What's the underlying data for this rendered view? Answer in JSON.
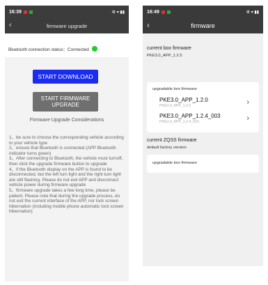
{
  "left": {
    "status_bar": {
      "time": "16:39",
      "icons": "⚙ ▾ ▮▮"
    },
    "header": {
      "title": "firmware upgrade"
    },
    "connection": {
      "label": "Bluetooth connection status：Connected"
    },
    "buttons": {
      "start_download": "START DOWNLOAD",
      "start_upgrade": "START FIRMWARE UPGRADE"
    },
    "considerations_title": "Firmware Upgrade Considerations",
    "notes": [
      "1、be sure to choose the corresponding vehicle according to your vehicle type",
      "2、ensure that Bluetooth is connected (APP Bluetooth indicator turns green)",
      "3、After connecting to Bluetooth, the vehicle must turnoff, then click the upgrade firmware button to upgrade",
      "4、if the Bluetooth display on the APP is found to be disconnected, but the left turn light and the right turn light are still flashing. Please do not exit APP and disconnect vehicle power during firmware upgrade",
      "5、firmware upgrade takes a few long time, please be patient. Please note that during the upgrade process, do not exit the current interface of the APP, nor lock screen hibernation (including mobile phone automatic lock screen hibernation)"
    ]
  },
  "right": {
    "status_bar": {
      "time": "16:49",
      "icons": "⚙ ▾ ▮▮"
    },
    "header": {
      "title": "firmware"
    },
    "current_box": {
      "label": "current box firmware",
      "value": "PKE3.0_APP_1.2.5"
    },
    "upgradable_box": {
      "caption": "upgradable box firmware",
      "items": [
        {
          "name": "PKE3.0_APP_1.2.0",
          "sub": "PKE3.0_APP_1.2.0"
        },
        {
          "name": "PKE3.0_APP_1.2.4_003",
          "sub": "PKE3.0_APP_1.2.4_003"
        }
      ]
    },
    "current_zqss": {
      "label": "current ZQSS firmware",
      "value": "default factory version"
    },
    "upgradable_box2": {
      "caption": "upgradable box firmware"
    }
  },
  "colors": {
    "download_button": "#1a2cf0",
    "upgrade_button": "#6f6f6f",
    "connected": "#22cc22",
    "header": "#3c3c3c"
  }
}
